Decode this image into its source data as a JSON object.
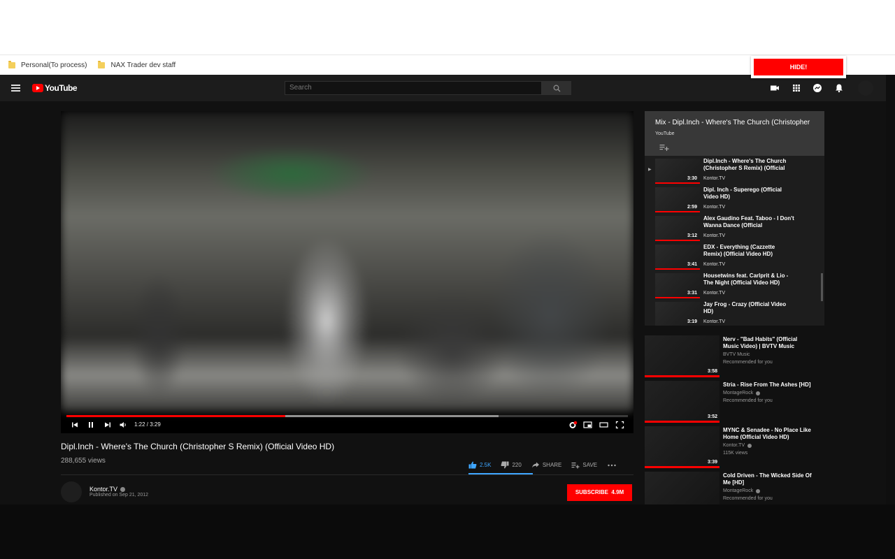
{
  "bookmarks": [
    {
      "label": "Personal(To process)"
    },
    {
      "label": "NAX Trader dev staff"
    }
  ],
  "extension": {
    "hide_label": "HIDE!"
  },
  "masthead": {
    "logo_text": "YouTube",
    "search_placeholder": "Search"
  },
  "player": {
    "time_display": "1:22 / 3:29",
    "progress_fraction": 0.39,
    "buffered_fraction": 0.77
  },
  "video": {
    "title": "Dipl.Inch - Where's The Church (Christopher S Remix) (Official Video HD)",
    "views": "288,655 views",
    "likes": "2.5K",
    "dislikes": "220",
    "share_label": "SHARE",
    "save_label": "SAVE"
  },
  "channel": {
    "name": "Kontor.TV",
    "published": "Published on Sep 21, 2012",
    "subscribe_label": "SUBSCRIBE",
    "subscriber_count": "4.9M"
  },
  "playlist": {
    "title": "Mix - Dipl.Inch - Where's The Church (Christopher",
    "subtitle": "YouTube",
    "items": [
      {
        "title": "Dipl.Inch - Where's The Church (Christopher S Remix) (Official",
        "channel": "Kontor.TV",
        "duration": "3:30",
        "playing": true
      },
      {
        "title": "Dipl. Inch - Superego (Official Video HD)",
        "channel": "Kontor.TV",
        "duration": "2:59",
        "playing": false
      },
      {
        "title": "Alex Gaudino Feat. Taboo - I Don't Wanna Dance (Official",
        "channel": "Kontor.TV",
        "duration": "3:12",
        "playing": false
      },
      {
        "title": "EDX - Everything (Cazzette Remix) (Official Video HD)",
        "channel": "Kontor.TV",
        "duration": "3:41",
        "playing": false
      },
      {
        "title": "Housetwins feat. Carlprit & Lio - The Night (Official Video HD)",
        "channel": "Kontor.TV",
        "duration": "3:31",
        "playing": false
      },
      {
        "title": "Jay Frog - Crazy (Official Video HD)",
        "channel": "Kontor.TV",
        "duration": "3:19",
        "playing": false
      }
    ]
  },
  "recommendations": [
    {
      "title": "Nerv - \"Bad Habits\" (Official Music Video) | BVTV Music",
      "channel": "BVTV Music",
      "meta": "Recommended for you",
      "duration": "3:58"
    },
    {
      "title": "Stria - Rise From The Ashes [HD]",
      "channel": "MontageRock",
      "meta": "Recommended for you",
      "duration": "3:52"
    },
    {
      "title": "MYNC & Senadee - No Place Like Home (Official Video HD)",
      "channel": "Kontor.TV",
      "meta": "115K views",
      "duration": "3:39"
    },
    {
      "title": "Cold Driven - The Wicked Side Of Me [HD]",
      "channel": "MontageRock",
      "meta": "Recommended for you",
      "duration": ""
    }
  ],
  "colors": {
    "accent": "#ff0000",
    "like": "#3ea6ff",
    "background": "#111111"
  }
}
